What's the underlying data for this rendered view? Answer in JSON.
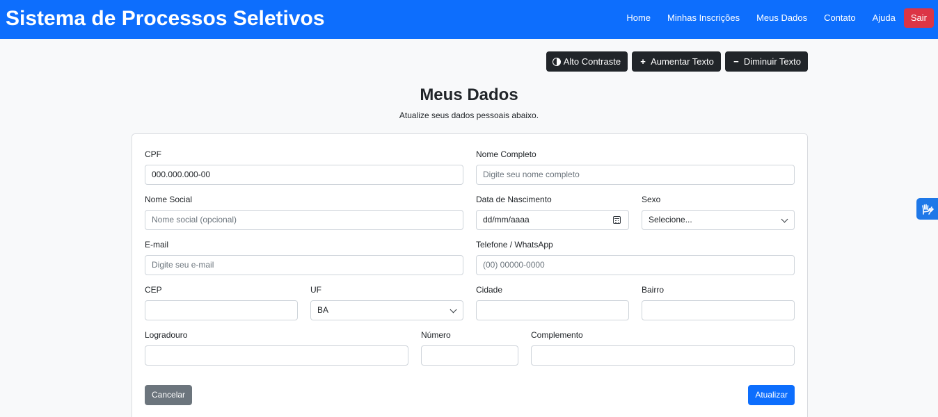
{
  "header": {
    "brand": "Sistema de Processos Seletivos",
    "nav": [
      "Home",
      "Minhas Inscrições",
      "Meus Dados",
      "Contato",
      "Ajuda"
    ],
    "logout": "Sair"
  },
  "accessibility": {
    "contrast": "Alto Contraste",
    "increase": "Aumentar Texto",
    "decrease": "Diminuir Texto"
  },
  "page": {
    "title": "Meus Dados",
    "subtitle": "Atualize seus dados pessoais abaixo."
  },
  "form": {
    "cpf": {
      "label": "CPF",
      "value": "000.000.000-00"
    },
    "nome": {
      "label": "Nome Completo",
      "placeholder": "Digite seu nome completo"
    },
    "nome_social": {
      "label": "Nome Social",
      "placeholder": "Nome social (opcional)"
    },
    "nascimento": {
      "label": "Data de Nascimento",
      "placeholder": "dd/mm/aaaa"
    },
    "sexo": {
      "label": "Sexo",
      "value": "Selecione..."
    },
    "email": {
      "label": "E-mail",
      "placeholder": "Digite seu e-mail"
    },
    "telefone": {
      "label": "Telefone / WhatsApp",
      "placeholder": "(00) 00000-0000"
    },
    "cep": {
      "label": "CEP",
      "value": ""
    },
    "uf": {
      "label": "UF",
      "value": "BA"
    },
    "cidade": {
      "label": "Cidade",
      "value": ""
    },
    "bairro": {
      "label": "Bairro",
      "value": ""
    },
    "logradouro": {
      "label": "Logradouro",
      "value": ""
    },
    "numero": {
      "label": "Número",
      "value": ""
    },
    "complemento": {
      "label": "Complemento",
      "value": ""
    },
    "cancel": "Cancelar",
    "submit": "Atualizar"
  },
  "icons": {
    "contrast": "half-circle-icon",
    "increase": "plus-icon",
    "decrease": "minus-icon",
    "calendar": "calendar-icon",
    "chevron": "chevron-down-icon",
    "vlibras": "sign-language-hands-icon"
  },
  "colors": {
    "primary": "#0d6efd",
    "danger": "#dc3545",
    "dark": "#212529",
    "secondary": "#6c757d"
  }
}
